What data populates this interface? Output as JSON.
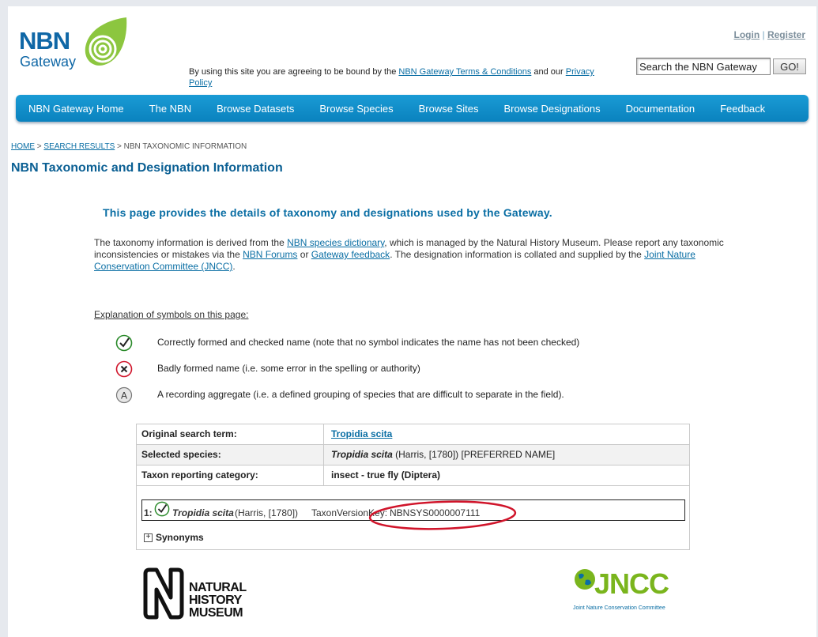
{
  "header": {
    "logo_main": "NBN",
    "logo_sub": "Gateway",
    "login_label": "Login",
    "separator": "|",
    "register_label": "Register",
    "terms_prefix": "By using this site you are agreeing to be bound by the ",
    "terms_link": "NBN Gateway Terms & Conditions",
    "terms_middle": " and our ",
    "privacy_link": "Privacy Policy",
    "search_value": "Search the NBN Gateway",
    "go_label": "GO!"
  },
  "nav": {
    "items": [
      "NBN Gateway Home",
      "The NBN",
      "Browse Datasets",
      "Browse Species",
      "Browse Sites",
      "Browse Designations",
      "Documentation",
      "Feedback"
    ]
  },
  "breadcrumb": {
    "home": "HOME",
    "sep": " > ",
    "results": "SEARCH RESULTS",
    "current": "NBN TAXONOMIC INFORMATION"
  },
  "page_title": "NBN Taxonomic and Designation Information",
  "intro": {
    "heading": "This page provides the details of taxonomy and designations used by the Gateway.",
    "p1": "The taxonomy information is derived from the ",
    "link_dictionary": "NBN species dictionary",
    "p2": ", which is managed by the Natural History Museum. Please report any taxonomic inconsistencies or mistakes via the ",
    "link_forums": "NBN Forums",
    "p3": " or ",
    "link_feedback": "Gateway feedback",
    "p4": ". The designation information is collated and supplied by the ",
    "link_jncc": "Joint Nature Conservation Committee (JNCC)",
    "p5": "."
  },
  "symbols": {
    "heading": "Explanation of symbols on this page:",
    "items": [
      {
        "icon": "checkmark-icon",
        "text": "Correctly formed and checked name (note that no symbol indicates the name has not been checked)"
      },
      {
        "icon": "cross-icon",
        "text": "Badly formed name (i.e. some error in the spelling or authority)"
      },
      {
        "icon": "aggregate-icon",
        "text": "A recording aggregate (i.e. a defined grouping of species that are difficult to separate in the field)."
      }
    ]
  },
  "info_table": {
    "rows": [
      {
        "label": "Original search term:",
        "value": "Tropidia scita"
      },
      {
        "label": "Selected species:",
        "value_name": "Tropidia scita",
        "value_rest": " (Harris, [1780])  [PREFERRED NAME]"
      },
      {
        "label": "Taxon reporting category:",
        "value": "insect - true fly (Diptera)"
      }
    ],
    "taxon_entry": {
      "index": "1:",
      "name": "Tropidia scita",
      "authority": "(Harris, [1780])",
      "key_label": "TaxonVersionKey:",
      "key_value": "NBNSYS0000007111"
    },
    "synonyms_label": "Synonyms"
  },
  "footer": {
    "nhm_lines": [
      "NATURAL",
      "HISTORY",
      "MUSEUM"
    ],
    "jncc_name": "JNCC",
    "jncc_full": "Joint Nature Conservation Committee"
  },
  "colors": {
    "nav_blue": "#0a82be",
    "title_blue": "#0a5f93",
    "link_blue": "#0a6ea4",
    "annotation_red": "#d0142a",
    "jncc_green": "#7ab51d"
  }
}
